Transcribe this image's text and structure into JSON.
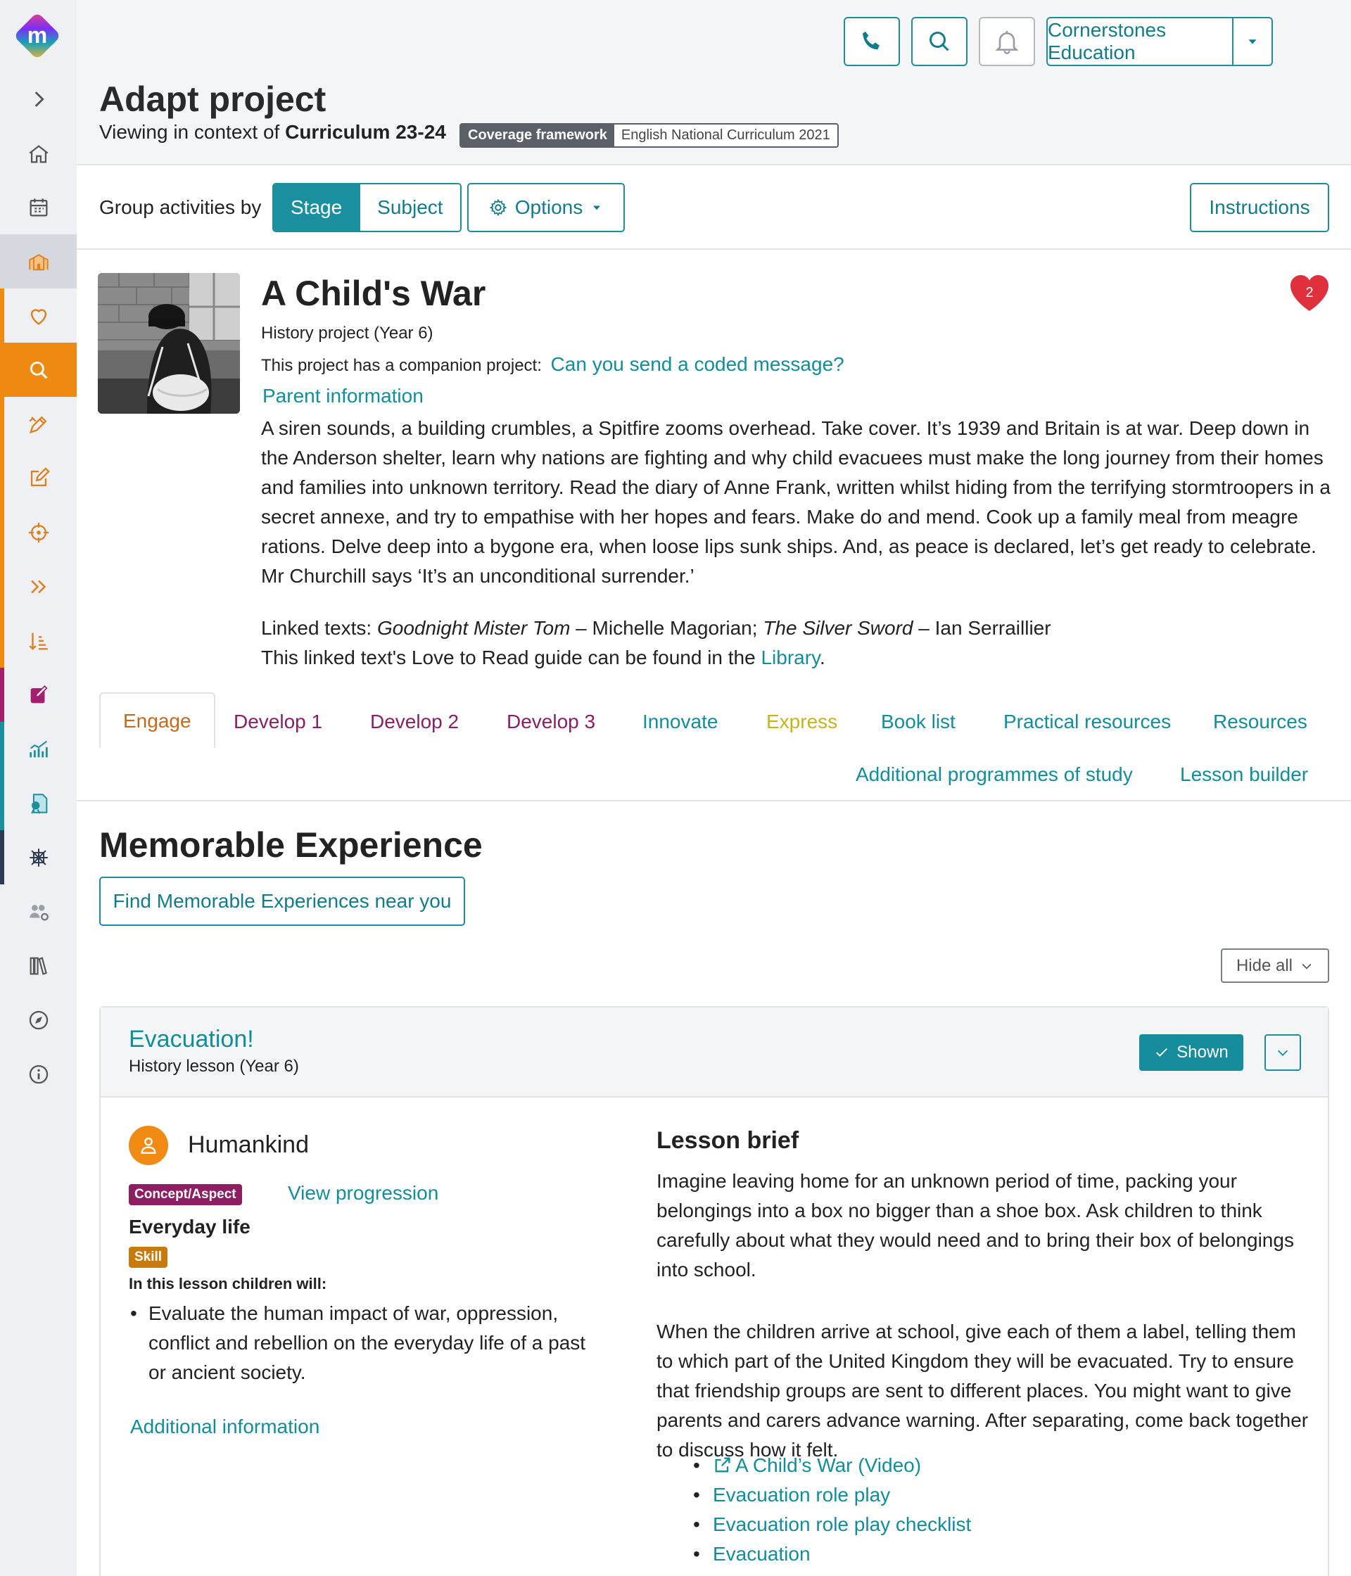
{
  "colors": {
    "accent": "#1a8f9e",
    "link": "#0f8e9e",
    "engage": "#c9681a",
    "develop": "#8e1d63",
    "innovate": "#0f8e9e",
    "express": "#c9b418",
    "heart": "#e0303d"
  },
  "sidebar": {
    "logo_letter": "m",
    "items": [
      {
        "icon": "chevron-right-icon"
      },
      {
        "icon": "home-icon"
      },
      {
        "icon": "calendar-icon"
      },
      {
        "icon": "school-icon"
      },
      {
        "icon": "heart-icon"
      },
      {
        "icon": "search-icon"
      },
      {
        "icon": "design-pencil-icon"
      },
      {
        "icon": "edit-icon"
      },
      {
        "icon": "target-icon"
      },
      {
        "icon": "double-chevron-icon"
      },
      {
        "icon": "sort-icon"
      },
      {
        "icon": "note-edit-icon"
      },
      {
        "icon": "chart-icon"
      },
      {
        "icon": "assessment-icon"
      },
      {
        "icon": "network-icon"
      },
      {
        "icon": "users-settings-icon"
      },
      {
        "icon": "library-icon"
      },
      {
        "icon": "compass-icon"
      },
      {
        "icon": "info-icon"
      }
    ]
  },
  "header": {
    "phone_icon": "phone-icon",
    "search_icon": "search-icon",
    "bell_icon": "bell-icon",
    "org_name": "Cornerstones Education",
    "title": "Adapt project",
    "context_prefix": "Viewing in context of",
    "context_value": "Curriculum 23-24",
    "coverage_label": "Coverage framework",
    "coverage_value": "English National Curriculum 2021"
  },
  "toolbar": {
    "group_label": "Group activities by",
    "stage": "Stage",
    "subject": "Subject",
    "options": "Options",
    "instructions": "Instructions"
  },
  "project": {
    "title": "A Child's War",
    "favourites_count": "2",
    "subtitle": "History project (Year 6)",
    "companion_prefix": "This project has a companion project:",
    "companion_link": "Can you send a coded message?",
    "parent_info": "Parent information",
    "description": "A siren sounds, a building crumbles, a Spitfire zooms overhead. Take cover. It’s 1939 and Britain is at war. Deep down in the Anderson shelter, learn why nations are fighting and why child evacuees must make the long journey from their homes and families into unknown territory. Read the diary of Anne Frank, written whilst hiding from the terrifying stormtroopers in a secret annexe, and try to empathise with her hopes and fears. Make do and mend. Cook up a family meal from meagre rations. Delve deep into a bygone era, when loose lips sunk ships. And, as peace is declared, let’s get ready to celebrate. Mr Churchill says ‘It’s an unconditional surrender.’",
    "linked_prefix": "Linked texts:",
    "linked_book1": "Goodnight Mister Tom",
    "linked_author1": " – Michelle Magorian; ",
    "linked_book2": "The Silver Sword",
    "linked_author2": " – Ian Serraillier",
    "guide_text": "This linked text's Love to Read guide can be found in the",
    "guide_link": "Library",
    "guide_end": "."
  },
  "tabs": [
    {
      "label": "Engage"
    },
    {
      "label": "Develop 1"
    },
    {
      "label": "Develop 2"
    },
    {
      "label": "Develop 3"
    },
    {
      "label": "Innovate"
    },
    {
      "label": "Express"
    },
    {
      "label": "Book list"
    },
    {
      "label": "Practical resources"
    },
    {
      "label": "Resources"
    },
    {
      "label": "Additional programmes of study"
    },
    {
      "label": "Lesson builder"
    }
  ],
  "section": {
    "title": "Memorable Experience",
    "find_button": "Find Memorable Experiences near you",
    "hide_all": "Hide all"
  },
  "lesson": {
    "title": "Evacuation!",
    "subtitle": "History lesson (Year 6)",
    "shown": "Shown",
    "concept": "Humankind",
    "concept_badge": "Concept/Aspect",
    "view_progression": "View progression",
    "aspect": "Everyday life",
    "skill_badge": "Skill",
    "children_will": "In this lesson children will:",
    "outcomes": [
      "Evaluate the human impact of war, oppression, conflict and rebellion on the everyday life of a past or ancient society."
    ],
    "additional_info": "Additional information",
    "brief_title": "Lesson brief",
    "brief_p1": "Imagine leaving home for an unknown period of time, packing your belongings into a box no bigger than a shoe box. Ask children to think carefully about what they would need and to bring their box of belongings into school.",
    "brief_p2": "When the children arrive at school, give each of them a label, telling them to which part of the United Kingdom they will be evacuated. Try to ensure that friendship groups are sent to different places. You might want to give parents and carers advance warning. After separating, come back together to discuss how it felt.",
    "resources": [
      "A Child’s War (Video)",
      "Evacuation role play",
      "Evacuation role play checklist",
      "Evacuation"
    ]
  }
}
